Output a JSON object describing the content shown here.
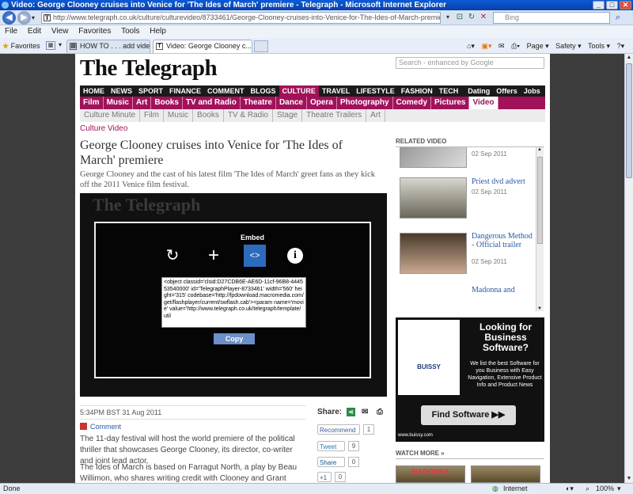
{
  "window": {
    "title": "Video: George Clooney cruises into Venice for 'The Ides of March' premiere - Telegraph - Microsoft Internet Explorer"
  },
  "browser": {
    "url": "http://www.telegraph.co.uk/culture/culturevideo/8733461/George-Clooney-cruises-into-Venice-for-The-Ides-of-March-premiere.html",
    "search_placeholder": "Bing",
    "menu": [
      "File",
      "Edit",
      "View",
      "Favorites",
      "Tools",
      "Help"
    ],
    "favorites_label": "Favorites",
    "tabs": [
      {
        "label": "HOW TO . . . add videos to ..."
      },
      {
        "label": "Video: George Clooney c..."
      }
    ],
    "commands": [
      "Page ▾",
      "Safety ▾",
      "Tools ▾",
      "?▾"
    ],
    "status": {
      "left": "Done",
      "zone": "Internet",
      "zoom": "100%"
    }
  },
  "site": {
    "logo": "The Telegraph",
    "search_placeholder": "Search - enhanced by Google",
    "topnav": [
      "HOME",
      "NEWS",
      "SPORT",
      "FINANCE",
      "COMMENT",
      "BLOGS",
      "CULTURE",
      "TRAVEL",
      "LIFESTYLE",
      "FASHION",
      "TECH",
      "Dating",
      "Offers",
      "Jobs"
    ],
    "secnav": [
      "Film",
      "Music",
      "Art",
      "Books",
      "TV and Radio",
      "Theatre",
      "Dance",
      "Opera",
      "Photography",
      "Comedy",
      "Pictures",
      "Video"
    ],
    "subnav": [
      "Culture Minute",
      "Film",
      "Music",
      "Books",
      "TV & Radio",
      "Stage",
      "Theatre Trailers",
      "Art"
    ]
  },
  "article": {
    "kicker": "Culture Video",
    "headline": "George Clooney cruises into Venice for 'The Ides of March' premiere",
    "standfirst": "George Clooney and the cast of his latest film 'The Ides of March' greet fans as they kick off the 2011 Venice film festival.",
    "dateline": "5:34PM BST 31 Aug 2011",
    "comment_label": "Comment",
    "para1": "The 11-day festival will host the world premiere of the political thriller that showcases George Clooney, its director, co-writer and joint lead actor.",
    "para2": "The Ides of March is based on Farragut North, a play by Beau Willimon, who shares writing credit with Clooney and Grant Heslov."
  },
  "player": {
    "watermark": "The Telegraph",
    "embed_title": "Embed",
    "embed_code": "<object classid='clsid:D27CDB6E-AE6D-11cf-96B8-444553540000' id='TelegraphPlayer-8733461' width='560' height='315' codebase='http://fpdownload.macromedia.com/get/flashplayer/current/swflash.cab'><param name='movie' value='http://www.telegraph.co.uk/telegraph/template/util",
    "copy_label": "Copy"
  },
  "share": {
    "label": "Share:",
    "recommend": "Recommend",
    "recommend_count": "1",
    "tweet": "Tweet",
    "tweet_count": "9",
    "linkedin": "Share",
    "linkedin_count": "0",
    "plusone": "+1",
    "plusone_count": "0"
  },
  "related": {
    "header": "RELATED VIDEO",
    "items": [
      {
        "title": "",
        "date": "02 Sep 2011"
      },
      {
        "title": "Priest dvd advert",
        "date": "02 Sep 2011"
      },
      {
        "title": "Dangerous Method - Official trailer",
        "date": "02 Sep 2011"
      },
      {
        "title": "Madonna and",
        "date": ""
      }
    ]
  },
  "ad": {
    "brand": "BUISSY",
    "headline": "Looking for Business Software?",
    "body": "We list the best Software for you Business with Easy Navigation, Extensive Product Info and Product News",
    "button": "Find Software",
    "url": "www.buissy.com"
  },
  "watch_more": {
    "header": "WATCH MORE »",
    "thumb1": "MADONNA"
  }
}
